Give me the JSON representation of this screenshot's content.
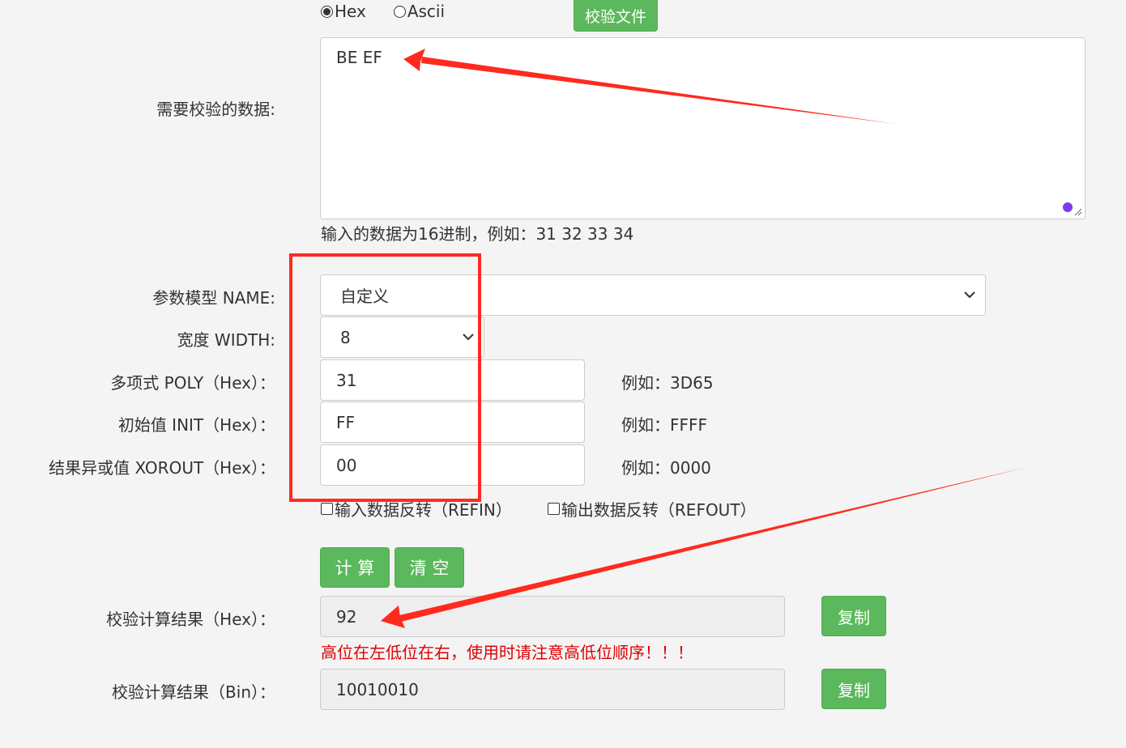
{
  "input_format": {
    "options": [
      {
        "label": "Hex",
        "checked": true
      },
      {
        "label": "Ascii",
        "checked": false
      }
    ]
  },
  "buttons": {
    "check_file": "校验文件",
    "calculate": "计 算",
    "clear": "清 空",
    "copy_hex": "复制",
    "copy_bin": "复制"
  },
  "data_input": {
    "label": "需要校验的数据:",
    "value": "BE EF",
    "help": "输入的数据为16进制，例如：31 32 33 34"
  },
  "params": {
    "name_label": "参数模型 NAME:",
    "name_value": "自定义",
    "width_label": "宽度 WIDTH:",
    "width_value": "8",
    "poly_label": "多项式 POLY（Hex）：",
    "poly_value": "31",
    "poly_example": "例如：3D65",
    "init_label": "初始值 INIT（Hex）：",
    "init_value": "FF",
    "init_example": "例如：FFFF",
    "xorout_label": "结果异或值 XOROUT（Hex）：",
    "xorout_value": "00",
    "xorout_example": "例如：0000",
    "refin_label": "输入数据反转（REFIN）",
    "refout_label": "输出数据反转（REFOUT）"
  },
  "results": {
    "hex_label": "校验计算结果（Hex）：",
    "hex_value": "92",
    "warning": "高位在左低位在右，使用时请注意高低位顺序！！！",
    "bin_label": "校验计算结果（Bin）：",
    "bin_value": "10010010"
  },
  "colors": {
    "button_green": "#5cb85c",
    "annotation_red": "#ff2a1f",
    "warning_red": "#dd0000"
  },
  "icons": [
    "chevron-down-icon",
    "resize-grip-icon",
    "annotation-arrow",
    "annotation-box"
  ]
}
